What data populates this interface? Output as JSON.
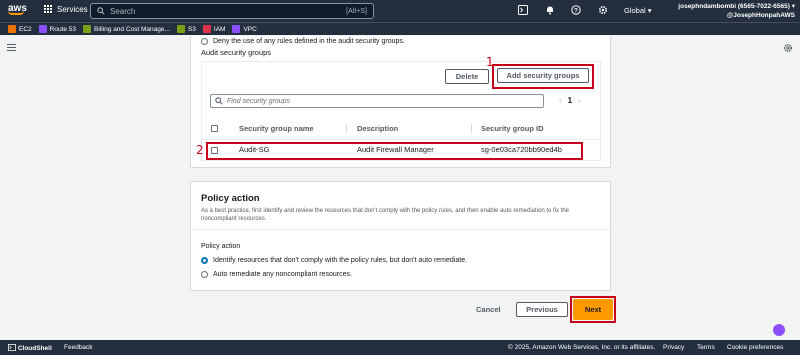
{
  "topnav": {
    "logo_text": "aws",
    "services_label": "Services",
    "search_placeholder": "Search",
    "search_shortcut": "[Alt+S]",
    "region_label": "Global",
    "account_name": "josephndambombi (6565-7022-6565)",
    "account_alias": "@JosephHonpahAWS"
  },
  "favorites": [
    {
      "label": "EC2",
      "color": "#ed7100"
    },
    {
      "label": "Route 53",
      "color": "#8c4fff"
    },
    {
      "label": "Billing and Cost Manage...",
      "color": "#7aa116"
    },
    {
      "label": "S3",
      "color": "#7aa116"
    },
    {
      "label": "IAM",
      "color": "#dd344c"
    },
    {
      "label": "VPC",
      "color": "#8c4fff"
    }
  ],
  "audit": {
    "deny_option": "Deny the use of any rules defined in the audit security groups.",
    "section_label": "Audit security groups",
    "delete_button": "Delete",
    "add_button": "Add security groups",
    "search_placeholder": "Find security groups",
    "page_number": "1",
    "columns": [
      "Security group name",
      "Description",
      "Security group ID"
    ],
    "row": {
      "name": "Audit-SG",
      "description": "Audit Firewall Manager",
      "id": "sg-0e03ca720bb90ed4b"
    },
    "annotation_1": "1",
    "annotation_2": "2"
  },
  "policy_action": {
    "title": "Policy action",
    "description": "As a best practice, first identify and review the resources that don't comply with the policy rules, and then enable auto remediation to fix the noncompliant resources.",
    "field_label": "Policy action",
    "options": [
      {
        "label": "Identify resources that don't comply with the policy rules, but don't auto remediate.",
        "selected": true
      },
      {
        "label": "Auto remediate any noncompliant resources.",
        "selected": false
      }
    ]
  },
  "actions": {
    "cancel": "Cancel",
    "previous": "Previous",
    "next": "Next"
  },
  "footer": {
    "cloudshell": "CloudShell",
    "feedback": "Feedback",
    "copyright": "© 2025, Amazon Web Services, Inc. or its affiliates.",
    "privacy": "Privacy",
    "terms": "Terms",
    "cookies": "Cookie preferences"
  },
  "colors": {
    "nav": "#232f3e",
    "primary": "#ff9900",
    "annotation": "#c7001b",
    "link": "#0073bb"
  }
}
